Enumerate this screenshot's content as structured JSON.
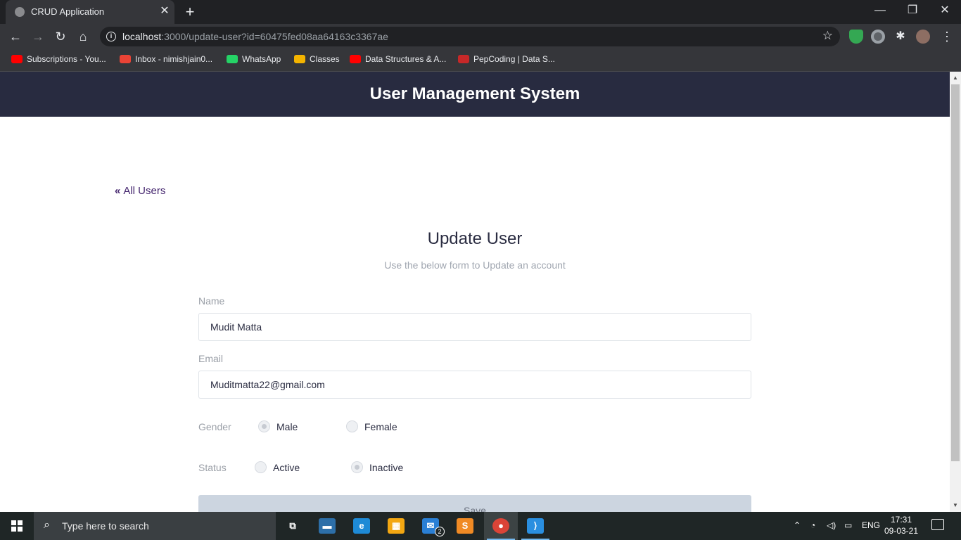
{
  "browser": {
    "tab": {
      "title": "CRUD Application",
      "close_glyph": "✕"
    },
    "new_tab_glyph": "+",
    "window_controls": {
      "minimize": "—",
      "restore": "❐",
      "close": "✕"
    },
    "nav": {
      "back": "←",
      "forward": "→",
      "reload": "↻",
      "home": "⌂"
    },
    "url": {
      "host": "localhost",
      "rest": ":3000/update-user?id=60475fed08aa64163c3367ae"
    },
    "bookmark_star": "☆",
    "bookmarks": [
      {
        "label": "Subscriptions - You...",
        "icon": "youtube-icon",
        "color": "#ff0000"
      },
      {
        "label": "Inbox - nimishjain0...",
        "icon": "gmail-icon",
        "color": "#ea4335"
      },
      {
        "label": "WhatsApp",
        "icon": "whatsapp-icon",
        "color": "#25d366"
      },
      {
        "label": "Classes",
        "icon": "google-classroom-icon",
        "color": "#f4b400"
      },
      {
        "label": "Data Structures & A...",
        "icon": "youtube-icon",
        "color": "#ff0000"
      },
      {
        "label": "PepCoding | Data S...",
        "icon": "pepcoding-icon",
        "color": "#c62828"
      }
    ]
  },
  "app": {
    "header_title": "User Management System",
    "back_link": {
      "chevron": "«",
      "label": "All Users"
    },
    "form": {
      "title": "Update User",
      "subtitle": "Use the below form to Update an account",
      "name_label": "Name",
      "name_value": "Mudit Matta",
      "email_label": "Email",
      "email_value": "Muditmatta22@gmail.com",
      "gender_label": "Gender",
      "gender_options": [
        "Male",
        "Female"
      ],
      "gender_selected": "Male",
      "status_label": "Status",
      "status_options": [
        "Active",
        "Inactive"
      ],
      "status_selected": "Inactive",
      "save_label": "Save"
    }
  },
  "taskbar": {
    "search_placeholder": "Type here to search",
    "apps": [
      {
        "name": "task-view",
        "glyph": "⧉",
        "color": "#1f2626"
      },
      {
        "name": "file-explorer",
        "glyph": "▬",
        "color": "#2d6fa8"
      },
      {
        "name": "edge",
        "glyph": "e",
        "color": "#1e8ad6"
      },
      {
        "name": "store",
        "glyph": "▦",
        "color": "#f3a712"
      },
      {
        "name": "mail",
        "glyph": "✉",
        "color": "#2a7fd4"
      },
      {
        "name": "sublime-text",
        "glyph": "S",
        "color": "#f08a24"
      },
      {
        "name": "chrome",
        "glyph": "●",
        "color": "#db4437"
      },
      {
        "name": "vscode",
        "glyph": "⟩",
        "color": "#2a8fe0"
      }
    ],
    "mail_badge": "2",
    "language": "ENG",
    "time": "17:31",
    "date": "09-03-21"
  }
}
